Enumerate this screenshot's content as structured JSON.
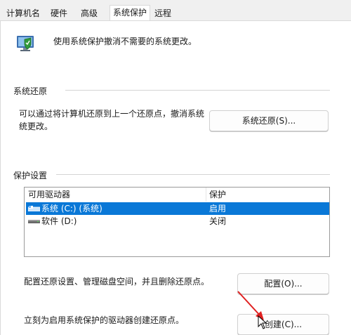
{
  "tabs": [
    "计算机名",
    "硬件",
    "高级",
    "系统保护",
    "远程"
  ],
  "active_tab": "系统保护",
  "header": {
    "description": "使用系统保护撤消不需要的系统更改。",
    "icon": "system-protection-shield-icon"
  },
  "restore": {
    "group_title": "系统还原",
    "text_line1": "可以通过将计算机还原到上一个还原点，撤消系统",
    "text_line2": "统更改。",
    "button_label": "系统还原(S)..."
  },
  "protection": {
    "group_title": "保护设置",
    "columns": [
      "可用驱动器",
      "保护"
    ],
    "drives": [
      {
        "name": "系统 (C:) (系统)",
        "protection": "启用",
        "selected": true,
        "icon": "system-drive-icon"
      },
      {
        "name": "软件 (D:)",
        "protection": "关闭",
        "selected": false,
        "icon": "drive-icon"
      }
    ],
    "configure_text": "配置还原设置、管理磁盘空间，并且删除还原点。",
    "configure_button": "配置(O)...",
    "create_text": "立刻为启用系统保护的驱动器创建还原点。",
    "create_button": "创建(C)..."
  },
  "colors": {
    "selection": "#0a78d7",
    "annotation_arrow": "#e02020"
  }
}
